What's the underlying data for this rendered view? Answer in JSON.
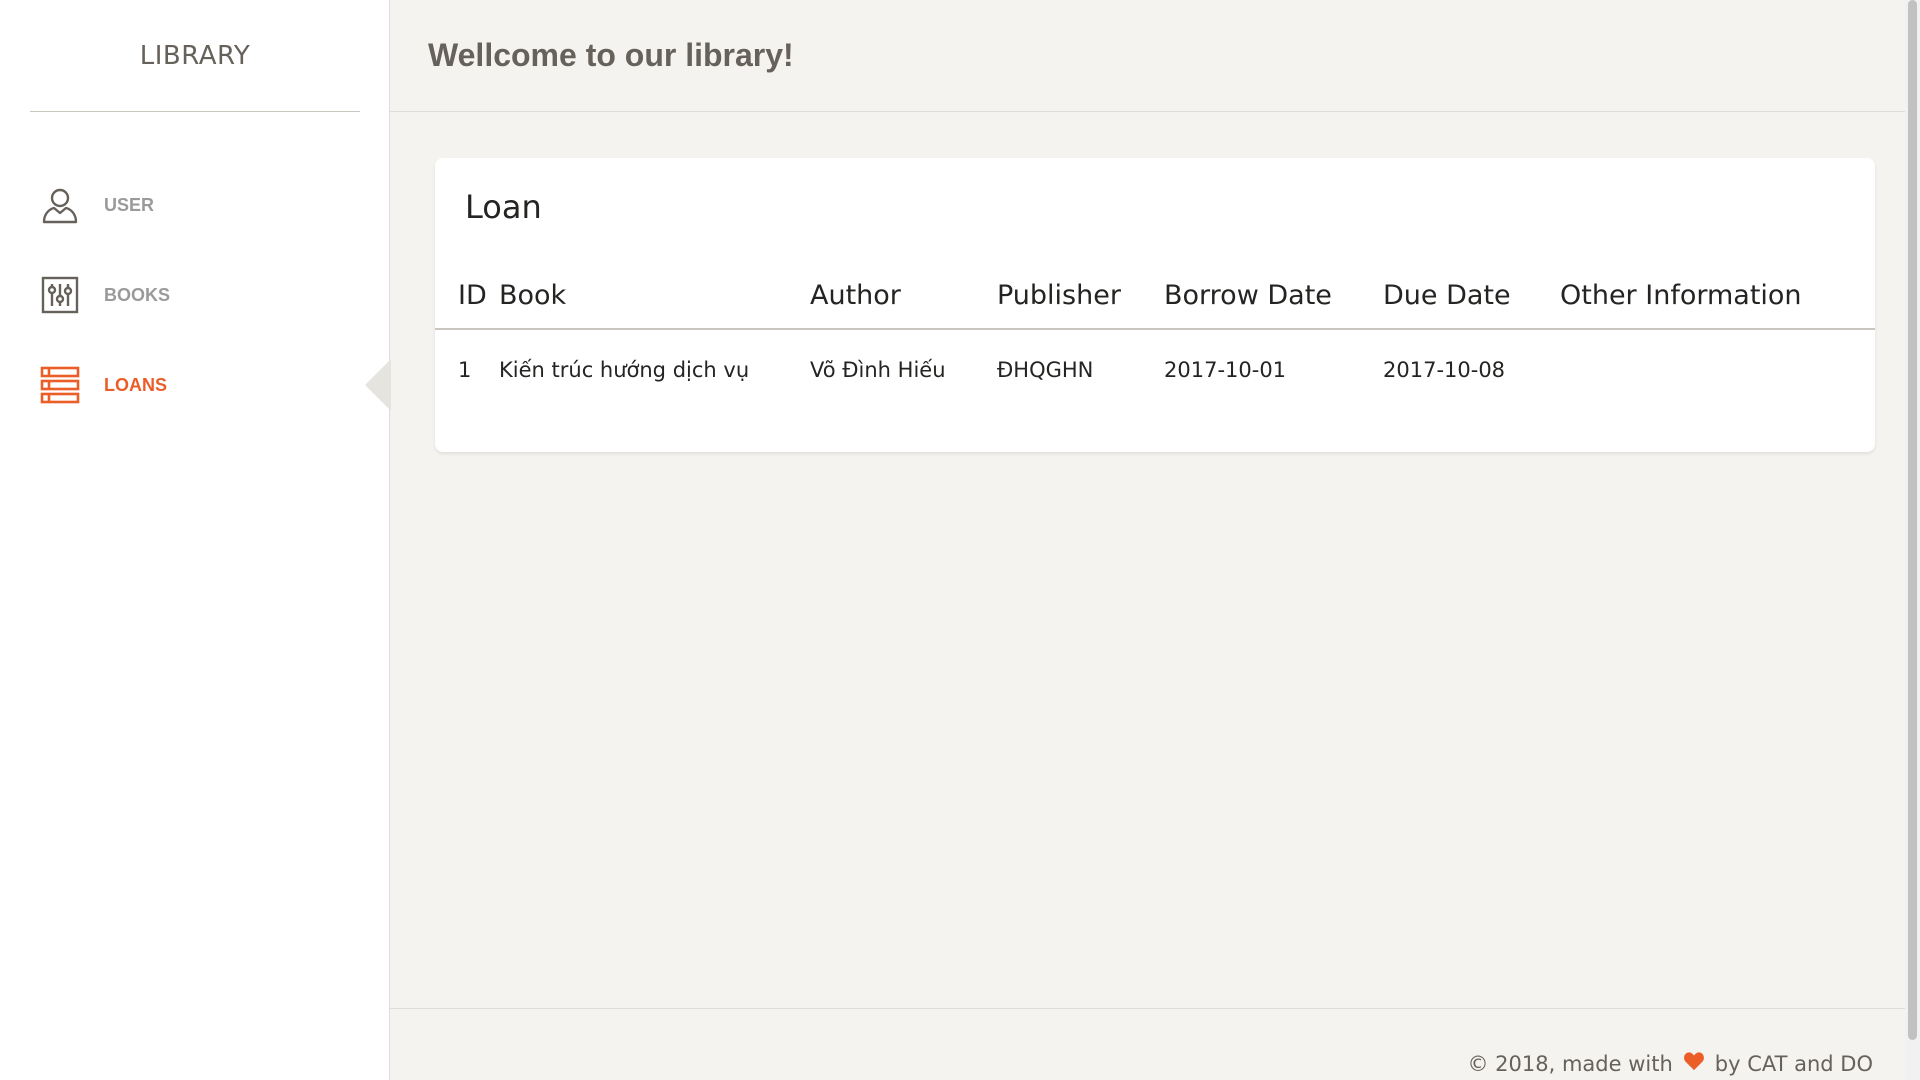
{
  "sidebar": {
    "logo": "LIBRARY",
    "items": [
      {
        "label": "USER",
        "icon": "user-icon"
      },
      {
        "label": "BOOKS",
        "icon": "settings-sliders-icon"
      },
      {
        "label": "LOANS",
        "icon": "list-icon",
        "active": true
      }
    ]
  },
  "header": {
    "title": "Wellcome to our library!"
  },
  "card": {
    "title": "Loan",
    "columns": [
      "ID",
      "Book",
      "Author",
      "Publisher",
      "Borrow Date",
      "Due Date",
      "Other Information"
    ],
    "rows": [
      {
        "id": "1",
        "book": "Kiến trúc hướng dịch vụ",
        "author": "Võ Đình Hiếu",
        "publisher": "ĐHQGHN",
        "borrow_date": "2017-10-01",
        "due_date": "2017-10-08",
        "other": ""
      }
    ]
  },
  "footer": {
    "prefix": "© 2018, made with",
    "suffix": "by CAT and DO",
    "heart_icon": "heart-icon"
  },
  "colors": {
    "accent": "#eb5e28",
    "muted": "#9a9a9a",
    "background": "#f4f3ef",
    "text": "#252422"
  }
}
